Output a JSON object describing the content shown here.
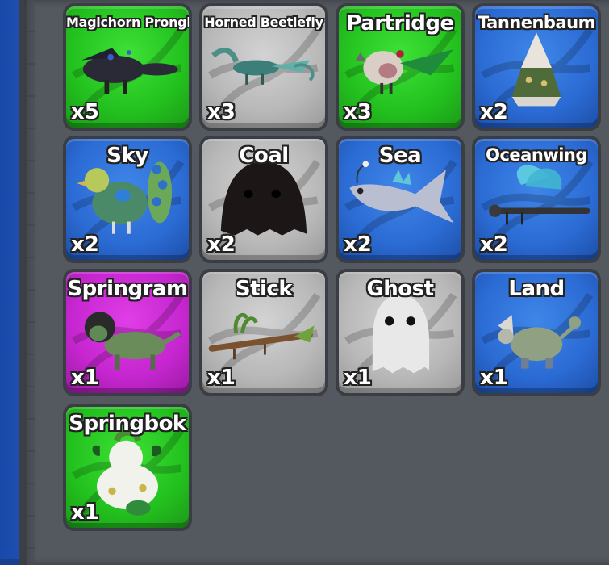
{
  "inventory": {
    "pets": [
      {
        "name": "Magichorn Prongbug",
        "count": "x5",
        "rarity": "green",
        "icon": "magichorn-prongbug-icon"
      },
      {
        "name": "Horned Beetlefly",
        "count": "x3",
        "rarity": "gray",
        "icon": "horned-beetlefly-icon"
      },
      {
        "name": "Partridge",
        "count": "x3",
        "rarity": "green",
        "icon": "partridge-icon"
      },
      {
        "name": "Tannenbaum",
        "count": "x2",
        "rarity": "blue",
        "icon": "tannenbaum-icon"
      },
      {
        "name": "Sky",
        "count": "x2",
        "rarity": "blue",
        "icon": "sky-bird-icon"
      },
      {
        "name": "Coal",
        "count": "x2",
        "rarity": "gray",
        "icon": "coal-ghost-icon"
      },
      {
        "name": "Sea",
        "count": "x2",
        "rarity": "blue",
        "icon": "sea-fish-icon"
      },
      {
        "name": "Oceanwing",
        "count": "x2",
        "rarity": "blue",
        "icon": "oceanwing-dragonfly-icon"
      },
      {
        "name": "Springram",
        "count": "x1",
        "rarity": "pink",
        "icon": "springram-icon"
      },
      {
        "name": "Stick",
        "count": "x1",
        "rarity": "gray",
        "icon": "stick-insect-icon"
      },
      {
        "name": "Ghost",
        "count": "x1",
        "rarity": "gray",
        "icon": "ghost-icon"
      },
      {
        "name": "Land",
        "count": "x1",
        "rarity": "blue",
        "icon": "land-creature-icon"
      },
      {
        "name": "Springbok",
        "count": "x1",
        "rarity": "green",
        "icon": "springbok-icon"
      }
    ]
  },
  "colors": {
    "green": "#23c11e",
    "gray": "#b8b8b8",
    "blue": "#2b6bd4",
    "pink": "#c526cf",
    "panel": "#54585f"
  }
}
